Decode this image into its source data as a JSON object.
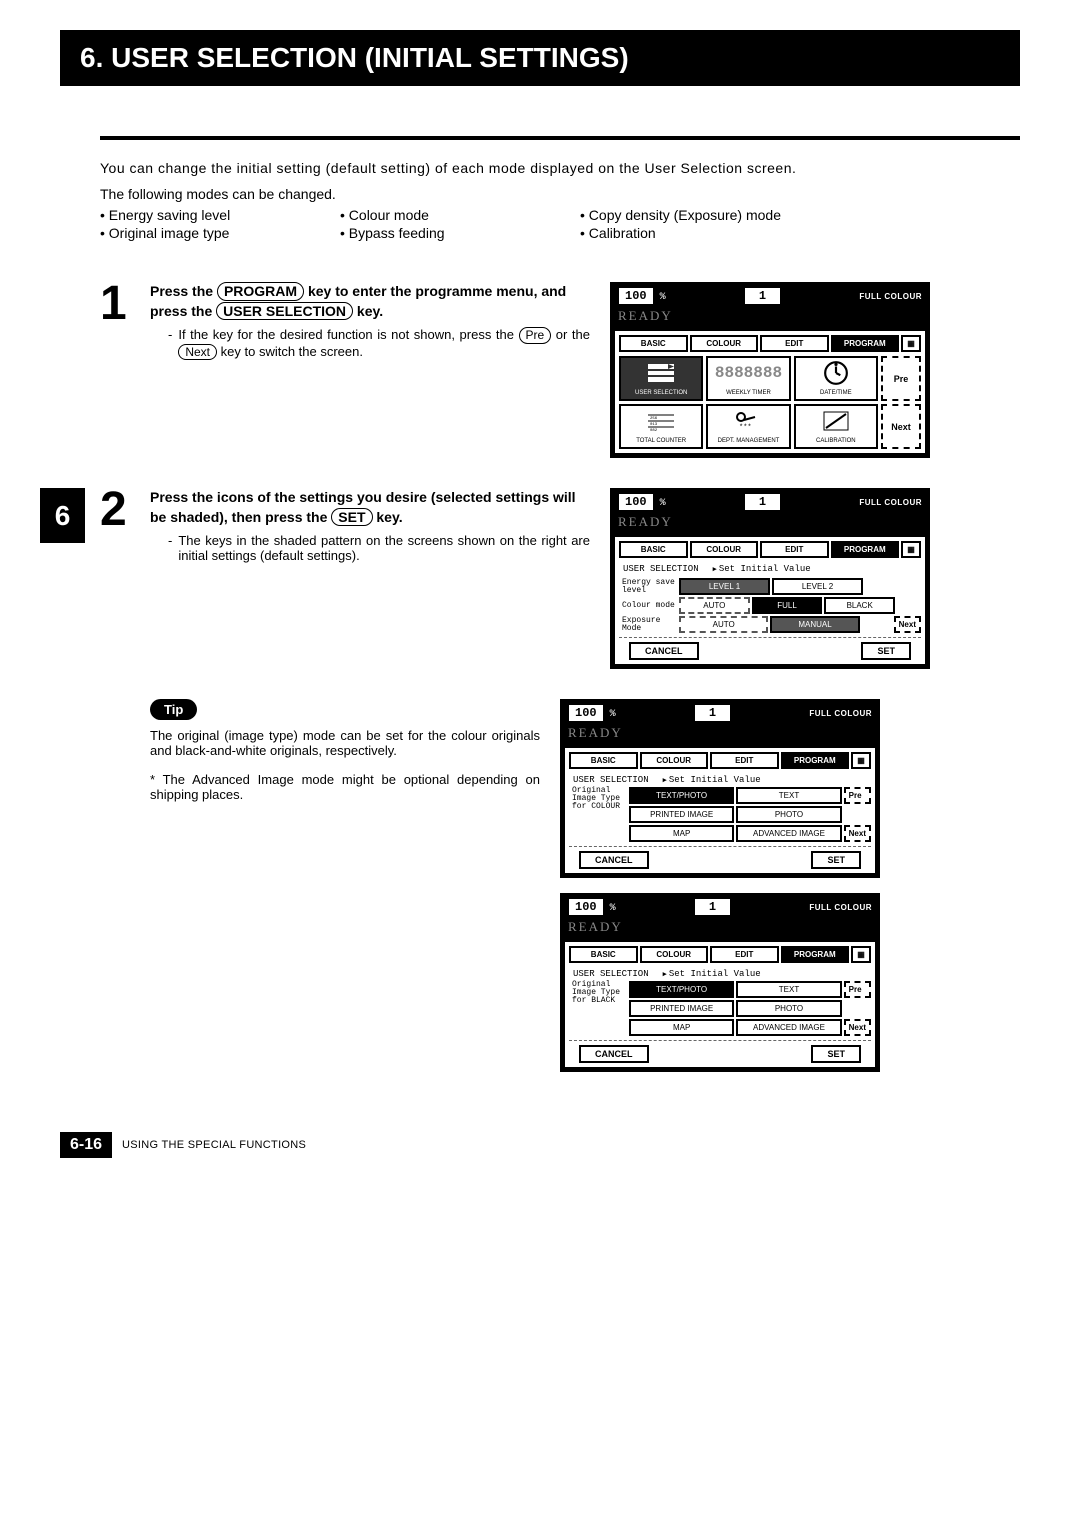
{
  "header": {
    "title": "6. USER SELECTION (INITIAL SETTINGS)"
  },
  "intro": {
    "para1": "You can change the initial setting (default setting) of each mode displayed on the User Selection screen.",
    "para2": "The following modes can be changed.",
    "modes": [
      "• Energy saving level",
      "• Original image type",
      "• Colour mode",
      "• Bypass feeding",
      "• Copy density (Exposure) mode",
      "• Calibration"
    ]
  },
  "section_tab": "6",
  "step1": {
    "num": "1",
    "heading_1": "Press the ",
    "key1": "PROGRAM",
    "heading_2": " key to enter the programme menu, and press the ",
    "key2": "USER SELECTION",
    "heading_3": " key.",
    "note1a": "If the key for the desired function is not shown, press the ",
    "key_pre": "Pre",
    "note1b": " or the ",
    "key_next": "Next",
    "note1c": " key to switch the screen."
  },
  "step2": {
    "num": "2",
    "heading_1": "Press the icons of the settings you desire (selected settings will be shaded), then press the ",
    "key1": "SET",
    "heading_2": " key.",
    "note1": "The keys in the shaded pattern on the screens shown on the right are initial settings (default settings)."
  },
  "tip": {
    "badge": "Tip",
    "text1": "The original (image type) mode can be set for the colour originals and black-and-white originals, respectively.",
    "text2": "* The Advanced Image mode might be optional depending on shipping places."
  },
  "screen_common": {
    "scale": "100",
    "pct": "%",
    "qty": "1",
    "full_colour": "FULL COLOUR",
    "ready": "READY",
    "tabs": {
      "basic": "BASIC",
      "colour": "COLOUR",
      "edit": "EDIT",
      "program": "PROGRAM"
    },
    "pre": "Pre",
    "next": "Next",
    "cancel": "CANCEL",
    "set": "SET"
  },
  "screen1": {
    "icons": [
      "USER SELECTION",
      "WEEKLY TIMER",
      "DATE/TIME",
      "TOTAL COUNTER",
      "DEPT. MANAGEMENT",
      "CALIBRATION"
    ],
    "segment1": "8888",
    "segment2": "888",
    "stars": "***"
  },
  "screen2": {
    "selection": "USER SELECTION",
    "set_initial": "Set Initial Value",
    "rows": [
      {
        "label": "Energy save level",
        "opts": [
          "LEVEL 1",
          "LEVEL 2"
        ]
      },
      {
        "label": "Colour mode",
        "opts": [
          "AUTO",
          "FULL",
          "BLACK"
        ]
      },
      {
        "label": "Exposure Mode",
        "opts": [
          "AUTO",
          "MANUAL"
        ]
      }
    ]
  },
  "screen3": {
    "selection": "USER SELECTION",
    "set_initial": "Set Initial Value",
    "label": "Original Image Type for COLOUR",
    "opts": [
      "TEXT/PHOTO",
      "TEXT",
      "PRINTED IMAGE",
      "PHOTO",
      "MAP",
      "ADVANCED IMAGE"
    ]
  },
  "screen4": {
    "selection": "USER SELECTION",
    "set_initial": "Set Initial Value",
    "label": "Original Image Type for BLACK",
    "opts": [
      "TEXT/PHOTO",
      "TEXT",
      "PRINTED IMAGE",
      "PHOTO",
      "MAP",
      "ADVANCED IMAGE"
    ]
  },
  "footer": {
    "page": "6-16",
    "text": "USING THE SPECIAL FUNCTIONS"
  }
}
